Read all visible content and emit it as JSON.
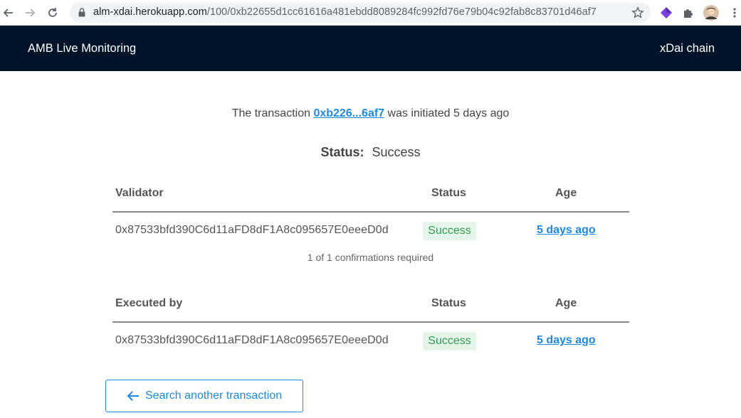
{
  "browser": {
    "url_host": "alm-xdai.herokuapp.com",
    "url_path": "/100/0xb22655d1cc61616a481ebdd8089284fc992fd76e79b04c92fab8c83701d46af7"
  },
  "header": {
    "title": "AMB Live Monitoring",
    "chain": "xDai chain"
  },
  "summary": {
    "prefix": "The transaction",
    "tx_short": "0xb226...6af7",
    "suffix": "was initiated 5 days ago"
  },
  "status": {
    "label": "Status:",
    "value": "Success"
  },
  "validators": {
    "headers": {
      "col1": "Validator",
      "col2": "Status",
      "col3": "Age"
    },
    "rows": [
      {
        "address": "0x87533bfd390C6d11aFD8dF1A8c095657E0eeeD0d",
        "status": "Success",
        "age": "5 days ago"
      }
    ],
    "confirmations": "1 of 1 confirmations required"
  },
  "execution": {
    "headers": {
      "col1": "Executed by",
      "col2": "Status",
      "col3": "Age"
    },
    "rows": [
      {
        "address": "0x87533bfd390C6d11aFD8dF1A8c095657E0eeeD0d",
        "status": "Success",
        "age": "5 days ago"
      }
    ]
  },
  "search_button": {
    "label": "Search another transaction"
  },
  "icons": {
    "back": "arrow-left-icon",
    "forward": "arrow-right-icon",
    "reload": "reload-icon",
    "lock": "lock-icon",
    "bookmark": "star-icon",
    "extension": "diamond-icon",
    "extensions_menu": "puzzle-icon",
    "profile": "avatar",
    "menu": "kebab-menu-icon",
    "search_arrow": "arrow-left-icon"
  },
  "colors": {
    "header_bg": "#001429",
    "link": "#1e88e5",
    "success_text": "#2e9c4f",
    "success_bg": "#e6f5ea"
  }
}
